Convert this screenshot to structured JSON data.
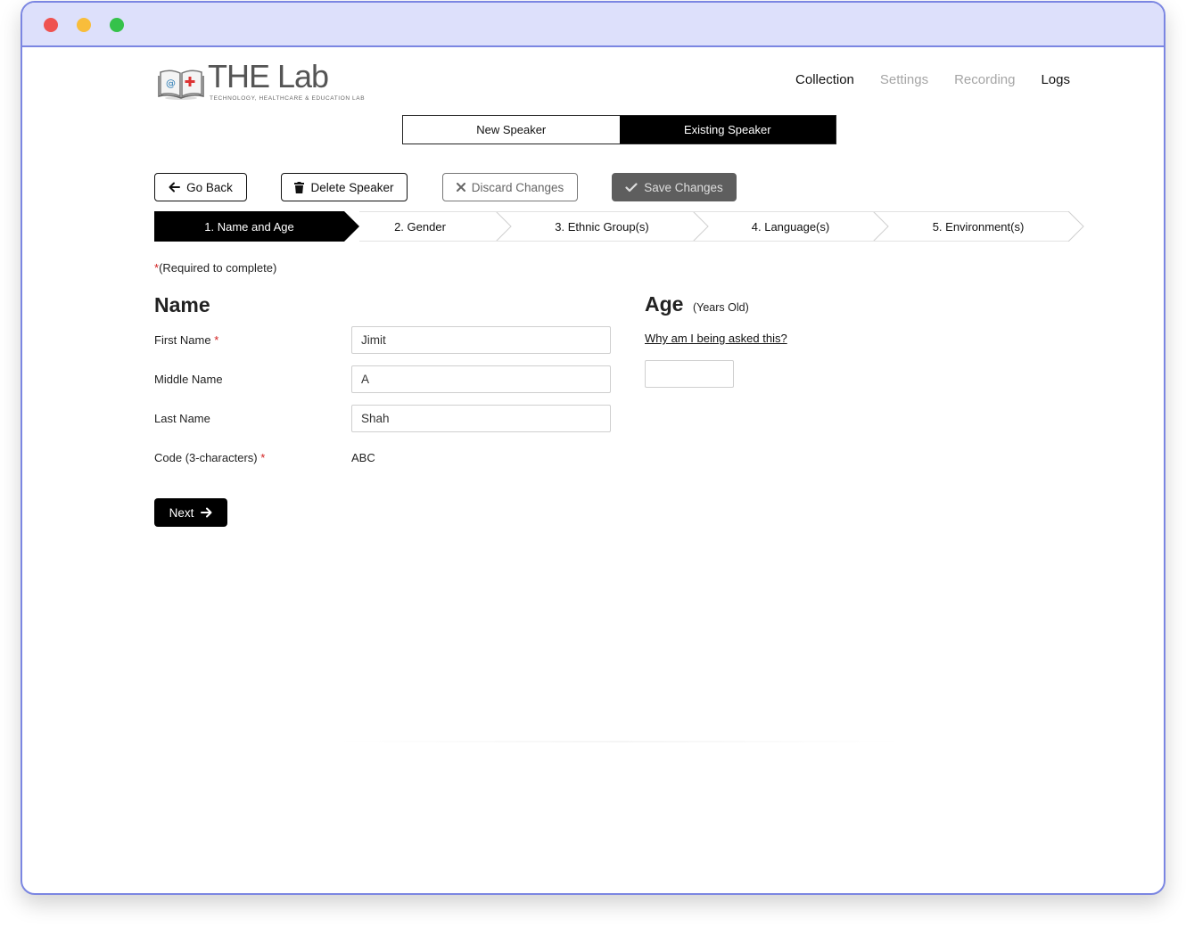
{
  "brand": {
    "title": "THE Lab",
    "subtitle": "TECHNOLOGY, HEALTHCARE & EDUCATION LAB",
    "icon": "book-medical-logo"
  },
  "nav": {
    "items": [
      {
        "label": "Collection",
        "state": "active"
      },
      {
        "label": "Settings",
        "state": "disabled"
      },
      {
        "label": "Recording",
        "state": "disabled"
      },
      {
        "label": "Logs",
        "state": "active"
      }
    ]
  },
  "speaker_toggle": {
    "new_label": "New Speaker",
    "existing_label": "Existing Speaker",
    "selected": "Existing Speaker"
  },
  "actions": {
    "go_back": "Go Back",
    "delete_speaker": "Delete Speaker",
    "discard_changes": "Discard Changes",
    "save_changes": "Save Changes"
  },
  "steps": [
    {
      "label": "1. Name and Age",
      "active": true
    },
    {
      "label": "2. Gender",
      "active": false
    },
    {
      "label": "3. Ethnic Group(s)",
      "active": false
    },
    {
      "label": "4. Language(s)",
      "active": false
    },
    {
      "label": "5. Environment(s)",
      "active": false
    }
  ],
  "required_note": {
    "asterisk": "*",
    "text": "(Required to complete)"
  },
  "name_section": {
    "title": "Name",
    "first_name_label": "First Name",
    "first_name_value": "Jimit",
    "middle_name_label": "Middle Name",
    "middle_name_value": "A",
    "last_name_label": "Last Name",
    "last_name_value": "Shah",
    "code_label": "Code (3-characters)",
    "code_value": "ABC",
    "required_mark": "*"
  },
  "age_section": {
    "title": "Age",
    "unit": "(Years Old)",
    "why_link": "Why am I being asked this?",
    "value": ""
  },
  "next_button": "Next",
  "colors": {
    "accent": "#000000",
    "required": "#d21f1f",
    "window_border": "#7b86e2",
    "titlebar": "#dde0fb",
    "save_button": "#5e5e5e"
  }
}
